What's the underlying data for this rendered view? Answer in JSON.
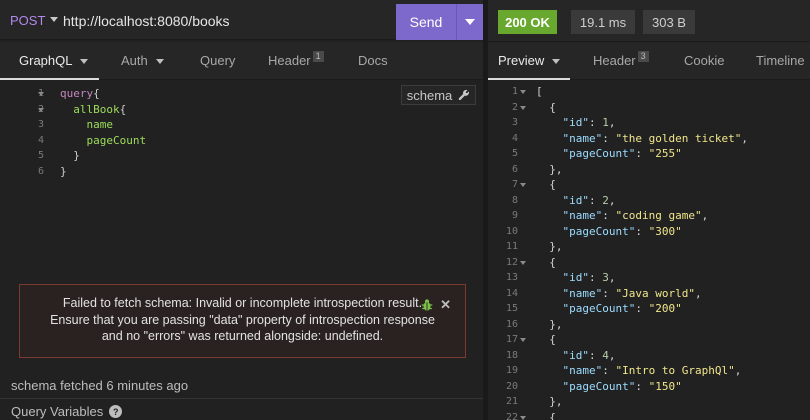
{
  "request": {
    "method": "POST",
    "url": "http://localhost:8080/books",
    "send_label": "Send"
  },
  "response_meta": {
    "status": "200 OK",
    "time": "19.1 ms",
    "size": "303 B"
  },
  "left_tabs": [
    {
      "label": "GraphQL",
      "active": true
    },
    {
      "label": "Auth"
    },
    {
      "label": "Query"
    },
    {
      "label": "Header",
      "badge": "1"
    },
    {
      "label": "Docs"
    }
  ],
  "right_tabs": [
    {
      "label": "Preview",
      "active": true
    },
    {
      "label": "Header",
      "badge": "3"
    },
    {
      "label": "Cookie"
    },
    {
      "label": "Timeline"
    }
  ],
  "query_lines": [
    {
      "n": "1",
      "fold": true,
      "text": "query{"
    },
    {
      "n": "2",
      "fold": true,
      "text": "  allBook{"
    },
    {
      "n": "3",
      "fold": false,
      "text": "    name"
    },
    {
      "n": "4",
      "fold": false,
      "text": "    pageCount"
    },
    {
      "n": "5",
      "fold": false,
      "text": "  }"
    },
    {
      "n": "6",
      "fold": false,
      "text": "}"
    }
  ],
  "schema_button": "schema",
  "error": {
    "line1": "Failed to fetch schema: Invalid or incomplete introspection result.",
    "line2": "Ensure that you are passing \"data\" property of introspection response",
    "line3": "and no \"errors\" was returned alongside: undefined."
  },
  "schema_status": "schema fetched 6 minutes ago",
  "query_variables_label": "Query Variables",
  "response_lines": [
    {
      "n": "1",
      "fold": true,
      "text": "["
    },
    {
      "n": "2",
      "fold": true,
      "text": "  {"
    },
    {
      "n": "3",
      "fold": false,
      "text": "    \"id\": 1,"
    },
    {
      "n": "4",
      "fold": false,
      "text": "    \"name\": \"the golden ticket\","
    },
    {
      "n": "5",
      "fold": false,
      "text": "    \"pageCount\": \"255\""
    },
    {
      "n": "6",
      "fold": false,
      "text": "  },"
    },
    {
      "n": "7",
      "fold": true,
      "text": "  {"
    },
    {
      "n": "8",
      "fold": false,
      "text": "    \"id\": 2,"
    },
    {
      "n": "9",
      "fold": false,
      "text": "    \"name\": \"coding game\","
    },
    {
      "n": "10",
      "fold": false,
      "text": "    \"pageCount\": \"300\""
    },
    {
      "n": "11",
      "fold": false,
      "text": "  },"
    },
    {
      "n": "12",
      "fold": true,
      "text": "  {"
    },
    {
      "n": "13",
      "fold": false,
      "text": "    \"id\": 3,"
    },
    {
      "n": "14",
      "fold": false,
      "text": "    \"name\": \"Java world\","
    },
    {
      "n": "15",
      "fold": false,
      "text": "    \"pageCount\": \"200\""
    },
    {
      "n": "16",
      "fold": false,
      "text": "  },"
    },
    {
      "n": "17",
      "fold": true,
      "text": "  {"
    },
    {
      "n": "18",
      "fold": false,
      "text": "    \"id\": 4,"
    },
    {
      "n": "19",
      "fold": false,
      "text": "    \"name\": \"Intro to GraphQl\","
    },
    {
      "n": "20",
      "fold": false,
      "text": "    \"pageCount\": \"150\""
    },
    {
      "n": "21",
      "fold": false,
      "text": "  },"
    },
    {
      "n": "22",
      "fold": true,
      "text": "  {"
    }
  ]
}
